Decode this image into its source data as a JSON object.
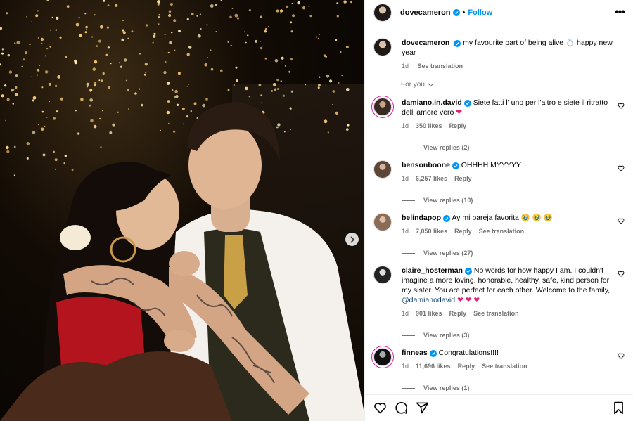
{
  "post": {
    "username": "dovecameron",
    "follow_label": "Follow",
    "more_label": "•••"
  },
  "caption": {
    "username": "dovecameron",
    "text": "my favourite part of being alive 💍 happy new year",
    "time": "1d",
    "translation": "See translation"
  },
  "filter_label": "For you",
  "comments": [
    {
      "username": "damiano.in.david",
      "text": "Siete fatti l' uno per l'altro e siete il ritratto dell' amore vero",
      "emoji": "❤",
      "time": "1d",
      "likes": "350 likes",
      "reply": "Reply",
      "translation": "",
      "replies": "View replies (2)"
    },
    {
      "username": "bensonboone",
      "text": "OHHHH MYYYYY",
      "emoji": "",
      "time": "1d",
      "likes": "6,257 likes",
      "reply": "Reply",
      "translation": "",
      "replies": "View replies (10)"
    },
    {
      "username": "belindapop",
      "text": "Ay mi pareja favorita",
      "emoji": "🥹 🥹 🥹",
      "time": "1d",
      "likes": "7,050 likes",
      "reply": "Reply",
      "translation": "See translation",
      "replies": "View replies (27)"
    },
    {
      "username": "claire_hosterman",
      "text": "No words for how happy I am. I couldn't imagine a more loving, honorable, healthy, safe, kind person for my sister. You are perfect for each other. Welcome to the family,",
      "mention": "@damianodavid",
      "emoji": "❤ ❤ ❤",
      "time": "1d",
      "likes": "901 likes",
      "reply": "Reply",
      "translation": "See translation",
      "replies": "View replies (3)"
    },
    {
      "username": "finneas",
      "text": "Congratulations!!!!",
      "emoji": "",
      "time": "1d",
      "likes": "11,696 likes",
      "reply": "Reply",
      "translation": "See translation",
      "replies": "View replies (1)"
    }
  ],
  "icons": {
    "like": "heart-icon",
    "comment": "comment-icon",
    "share": "share-icon",
    "save": "bookmark-icon",
    "next": "chevron-right-icon"
  },
  "colors": {
    "accent": "#0095f6",
    "muted": "#737373",
    "border": "#efefef",
    "heart": "#e11d74"
  }
}
